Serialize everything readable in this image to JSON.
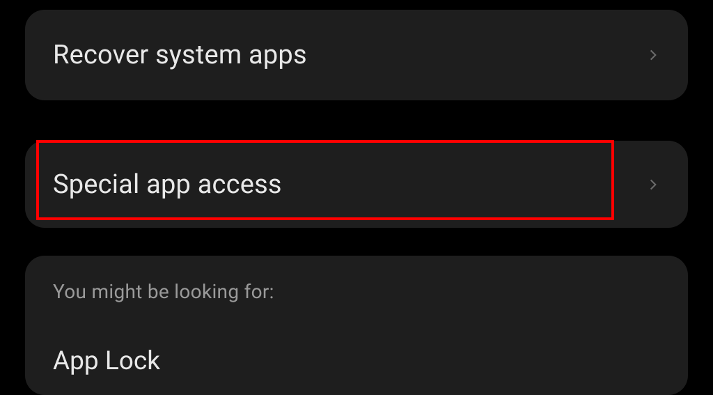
{
  "items": [
    {
      "label": "Recover system apps"
    },
    {
      "label": "Special app access"
    }
  ],
  "suggest": {
    "title": "You might be looking for:",
    "first_item": "App Lock"
  }
}
